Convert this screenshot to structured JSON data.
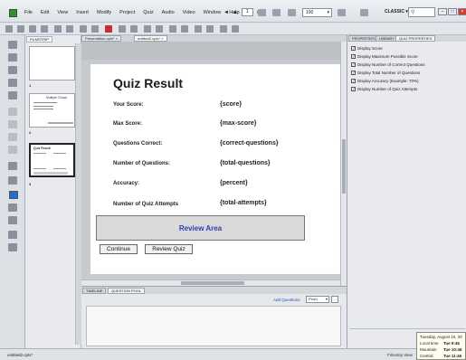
{
  "menu": {
    "items": [
      "File",
      "Edit",
      "View",
      "Insert",
      "Modify",
      "Project",
      "Quiz",
      "Audio",
      "Video",
      "Window",
      "Help"
    ],
    "current_page": "1",
    "separator": "/",
    "total_pages": "3",
    "zoom": "100",
    "workspace": "CLASSIC"
  },
  "filmstrip": {
    "tab_label": "FILMSTRIP",
    "slides": [
      {
        "number": "1",
        "title": ""
      },
      {
        "number": "2",
        "title": "Multiple Choice"
      },
      {
        "number": "3",
        "title": "Quiz Result"
      }
    ]
  },
  "doc_tabs": [
    "Presentation.cptx*",
    "untitled2.cptx*"
  ],
  "slide": {
    "title": "Quiz Result",
    "rows": [
      {
        "label": "Your Score:",
        "value": "{score}"
      },
      {
        "label": "Max Score:",
        "value": "{max-score}"
      },
      {
        "label": "Questions Correct:",
        "value": "{correct-questions}"
      },
      {
        "label": "Number of Questions:",
        "value": "{total-questions}"
      },
      {
        "label": "Accuracy:",
        "value": "{percent}"
      },
      {
        "label": "Number of Quiz Attempts",
        "value": "{total-attempts}"
      }
    ],
    "review_area": "Review Area",
    "continue_label": "Continue",
    "review_label": "Review Quiz"
  },
  "bottom_panel": {
    "tabs": [
      "TIMELINE",
      "QUESTION POOL"
    ],
    "add_questions": "Add Questions",
    "pool_select": "Pool1"
  },
  "right_panel": {
    "tabs": [
      "PROPERTIES",
      "LIBRARY",
      "QUIZ PROPERTIES"
    ],
    "options": [
      {
        "label": "Display Score",
        "checked": true
      },
      {
        "label": "Display Maximum Possible Score",
        "checked": true
      },
      {
        "label": "Display Number of Correct Questions",
        "checked": true
      },
      {
        "label": "Display Total Number of Questions",
        "checked": true
      },
      {
        "label": "Display Accuracy (Example: 70%)",
        "checked": true
      },
      {
        "label": "Display Number of Quiz Attempts",
        "checked": true
      }
    ]
  },
  "status": {
    "file": "untitled2.cptx*",
    "mode": "Filmstrip View"
  },
  "clock": {
    "date": "Tuesday, August 10, 20",
    "entries": [
      {
        "zone": "Local time",
        "time": "Tue 9:46"
      },
      {
        "zone": "Mountain",
        "time": "Tue 10:46"
      },
      {
        "zone": "Central",
        "time": "Tue 11:46"
      }
    ]
  },
  "colors": {
    "review_text": "#2d3fb0",
    "accent_fill": "#1f6fd0"
  }
}
